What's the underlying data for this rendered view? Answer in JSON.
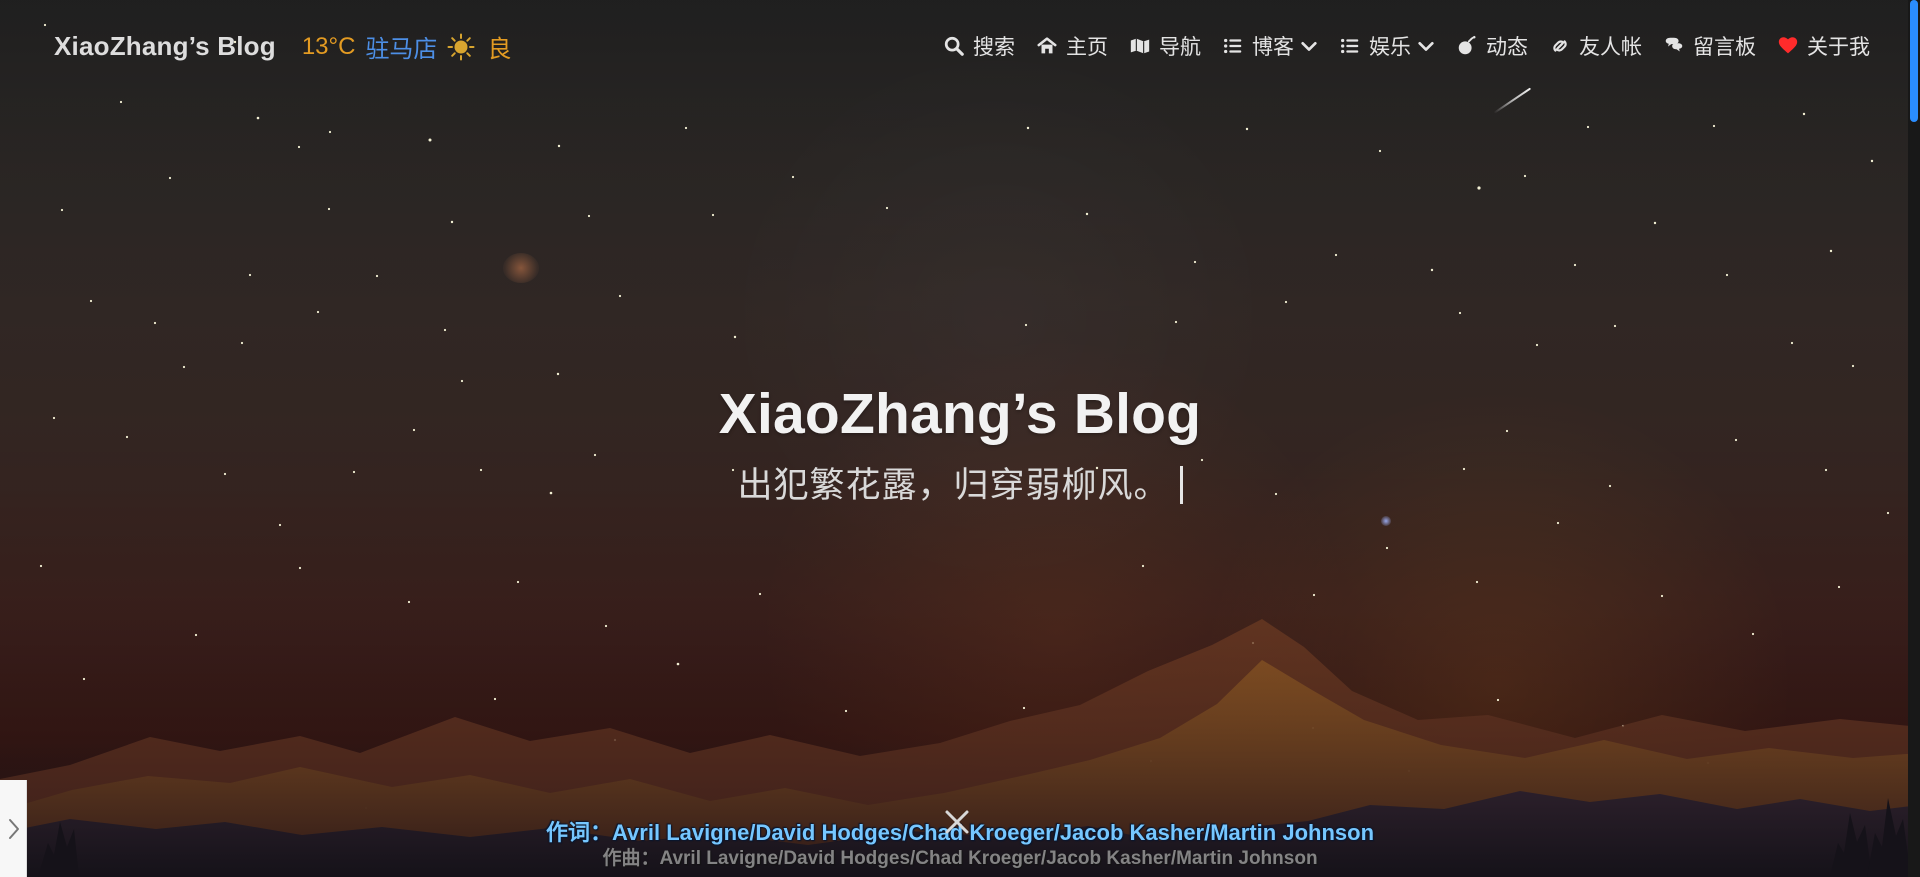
{
  "header": {
    "brand_title": "XiaoZhang’s Blog",
    "weather": {
      "temperature": "13°C",
      "city": "驻马店",
      "condition_icon": "sun-icon",
      "air_quality": "良",
      "colors": {
        "temperature": "#e39b22",
        "city": "#4d8fe6",
        "air_quality": "#e39b22"
      }
    },
    "nav": [
      {
        "label": "搜索",
        "icon": "search-icon"
      },
      {
        "label": "主页",
        "icon": "home-icon"
      },
      {
        "label": "导航",
        "icon": "map-icon"
      },
      {
        "label": "博客",
        "icon": "list-icon",
        "has_dropdown": true
      },
      {
        "label": "娱乐",
        "icon": "list-icon",
        "has_dropdown": true
      },
      {
        "label": "动态",
        "icon": "bomb-icon"
      },
      {
        "label": "友人帐",
        "icon": "link-icon"
      },
      {
        "label": "留言板",
        "icon": "chat-icon"
      },
      {
        "label": "关于我",
        "icon": "heart-icon"
      }
    ]
  },
  "hero": {
    "title": "XiaoZhang’s Blog",
    "subtitle": "出犯繁花露，归穿弱柳风。"
  },
  "lyrics": {
    "primary": "作词：Avril Lavigne/David Hodges/Chad Kroeger/Jacob Kasher/Martin Johnson",
    "secondary": "作曲：Avril Lavigne/David Hodges/Chad Kroeger/Jacob Kasher/Martin Johnson",
    "close_icon": "close-icon"
  },
  "side_panel": {
    "toggle_icon": "chevron-right-icon"
  },
  "theme": {
    "accent_blue": "#2a8dff",
    "lyrics_blue": "#76c7ff",
    "heart_red": "#ff2b2b",
    "text_light": "#e4e4e4"
  }
}
